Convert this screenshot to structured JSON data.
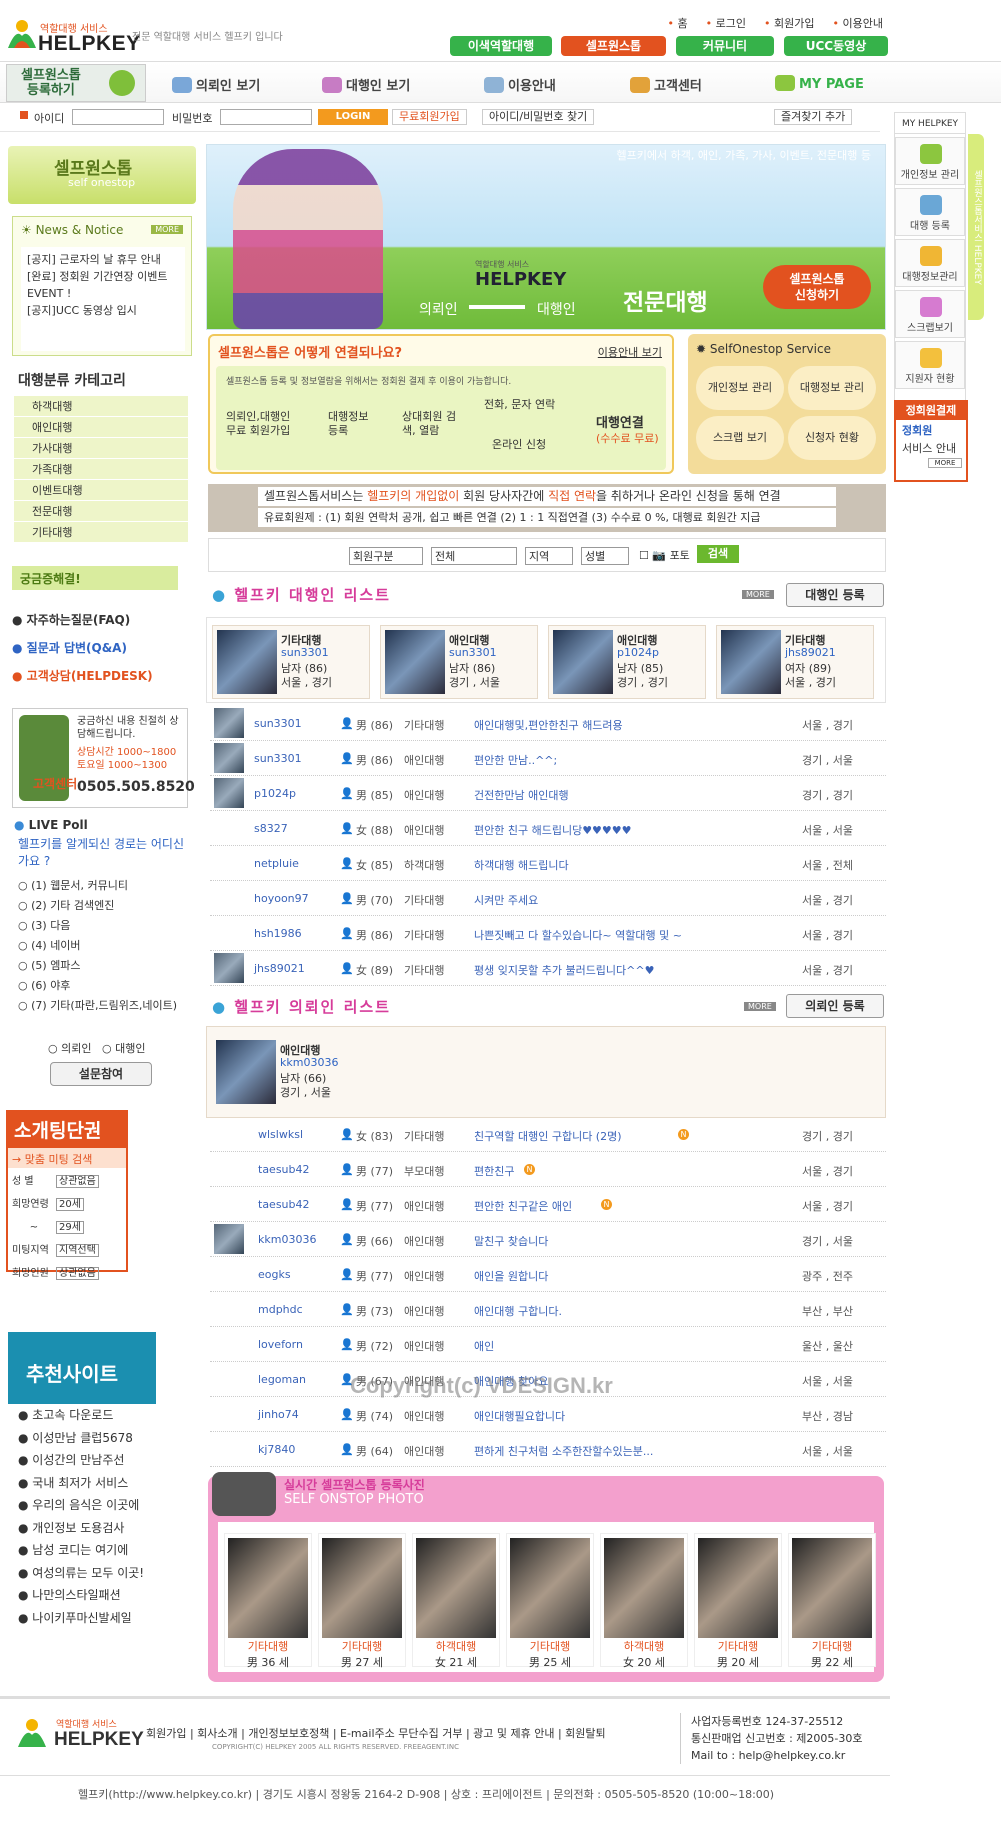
{
  "header": {
    "logo_small": "역할대행 서비스",
    "logo_text": "HELPKEY",
    "tagline": "전문 역할대행 서비스 헬프키 입니다",
    "toplinks": [
      "홈",
      "로그인",
      "회원가입",
      "이용안내"
    ],
    "tabs": [
      {
        "label": "이색역할대행",
        "color": "#36b24a"
      },
      {
        "label": "셀프원스톱",
        "color": "#e2521f"
      },
      {
        "label": "커뮤니티",
        "color": "#36b24a"
      },
      {
        "label": "UCC동영상",
        "color": "#36b24a"
      }
    ]
  },
  "nav": {
    "register": [
      "셀프원스톱",
      "등록하기"
    ],
    "items": [
      "의뢰인 보기",
      "대행인 보기",
      "이용안내",
      "고객센터",
      "MY PAGE"
    ]
  },
  "login": {
    "id_label": "아이디",
    "pw_label": "비밀번호",
    "login_btn": "LOGIN",
    "join": "무료회원가입",
    "find": "아이디/비밀번호 찾기",
    "fav": "즐겨찾기 추가"
  },
  "left": {
    "selfonestop": "셀프원스톱",
    "selfonestop_en": "self onestop",
    "news_title": "News & Notice",
    "news_more": "MORE",
    "news": [
      "[공지] 근로자의 날 휴무 안내",
      "[완료] 정회원 기간연장 이벤트 EVENT !",
      "[공지]UCC 동영상 입시"
    ],
    "category_title": "대행분류 카테고리",
    "categories": [
      "하객대행",
      "애인대행",
      "가사대행",
      "가족대행",
      "이벤트대행",
      "전문대행",
      "기타대행"
    ],
    "faq_title": "궁금증해결!",
    "faq": [
      "자주하는질문(FAQ)",
      "질문과 답변(Q&A)",
      "고객상담(HELPDESK)"
    ],
    "cs_text1": "궁금하신 내용 친절히 상담해드립니다.",
    "cs_hours1": "상담시간 1000~1800",
    "cs_hours2": "토요일 1000~1300",
    "cs_label": "고객센터",
    "cs_phone": "0505.505.8520",
    "poll_title": "LIVE Poll",
    "poll_question": "헬프키를 알게되신 경로는 어디신가요 ?",
    "poll_options": [
      "(1) 웹문서, 커뮤니티",
      "(2) 기타 검색엔진",
      "(3) 다음",
      "(4) 네이버",
      "(5) 엠파스",
      "(6) 야후",
      "(7) 기타(파란,드림위즈,네이트)"
    ],
    "poll_roles": [
      "의뢰인",
      "대행인"
    ],
    "poll_btn": "설문참여",
    "meeting_title": "소개팅단권",
    "meeting_search": "→ 맞춤 미팅 검색",
    "meeting_fields": [
      {
        "label": "성    별",
        "value": "상관없음"
      },
      {
        "label": "희망연령",
        "value": "20세"
      },
      {
        "label": "~",
        "value": "29세"
      },
      {
        "label": "미팅지역",
        "value": "지역선택"
      },
      {
        "label": "희망인원",
        "value": "상관없음"
      }
    ],
    "rec_title": "추천사이트",
    "rec": [
      "초고속 다운로드",
      "이성만남 클럽5678",
      "이성간의 만남주선",
      "국내 최저가 서비스",
      "우리의 음식은 이곳에",
      "개인정보 도용검사",
      "남성 코디는 여기에",
      "여성의류는 모두 이곳!",
      "나만의스타일패션",
      "나이키푸마신발세일"
    ]
  },
  "banner": {
    "top_text": "헬프키에서 하객, 애인, 가족, 가사, 이벤트, 전문대행 등",
    "brand_small": "역할대행 서비스",
    "brand": "HELPKEY",
    "left_word": "의뢰인",
    "right_word": "대행인",
    "big": "전문대행",
    "apply": [
      "셀프원스톱",
      "신청하기"
    ]
  },
  "howto": {
    "title": "셀프원스톱은 어떻게 연결되나요?",
    "guide": "이용안내 보기",
    "desc": "셀프원스톱 등록 및 정보열람을 위해서는 정회원 결제 후 이용이 가능합니다.",
    "steps": [
      "의뢰인,대행인 무료 회원가입",
      "대행정보 등록",
      "상대회원 검색, 열람",
      "전화, 문자 연락",
      "온라인 신청",
      "대행연결",
      "(수수료 무료)"
    ]
  },
  "service": {
    "title": "SelfOnestop Service",
    "items": [
      "개인정보 관리",
      "대행정보 관리",
      "스크랩 보기",
      "신청자 현황"
    ]
  },
  "notice": {
    "line1a": "셀프원스톱서비스는 ",
    "line1b": "헬프키의 개입없이",
    "line1c": " 회원 당사자간에 ",
    "line1d": "직접 연락",
    "line1e": "을 취하거나 온라인 신청을 통해 연결",
    "line2": "유료회원제 : (1) 회원 연락처 공개, 쉽고 빠른 연결 (2) 1 : 1 직접연결 (3) 수수료 0 %, 대행료 회원간 지급"
  },
  "search": {
    "member": "회원구분",
    "all": "전체",
    "region": "지역",
    "gender": "성별",
    "photo": "포토",
    "btn": "검색"
  },
  "agent_list": {
    "title": "헬프키 대행인 리스트",
    "more": "MORE",
    "register": "대행인 등록",
    "cards": [
      {
        "cat": "기타대행",
        "id": "sun3301",
        "info": "남자 (86)",
        "area": "서울 , 경기"
      },
      {
        "cat": "애인대행",
        "id": "sun3301",
        "info": "남자 (86)",
        "area": "경기 , 서울"
      },
      {
        "cat": "애인대행",
        "id": "p1024p",
        "info": "남자 (85)",
        "area": "경기 , 경기"
      },
      {
        "cat": "기타대행",
        "id": "jhs89021",
        "info": "여자 (89)",
        "area": "서울 , 경기"
      }
    ],
    "rows": [
      {
        "id": "sun3301",
        "sex": "男",
        "age": "(86)",
        "cat": "기타대행",
        "title": "애인대행및,편안한친구 해드려용",
        "area": "서울 , 경기",
        "photo": true
      },
      {
        "id": "sun3301",
        "sex": "男",
        "age": "(86)",
        "cat": "애인대행",
        "title": "편안한 만남..^^;",
        "area": "경기 , 서울",
        "photo": true
      },
      {
        "id": "p1024p",
        "sex": "男",
        "age": "(85)",
        "cat": "애인대행",
        "title": "건전한만남 애인대행",
        "area": "경기 , 경기",
        "photo": true
      },
      {
        "id": "s8327",
        "sex": "女",
        "age": "(88)",
        "cat": "애인대행",
        "title": "편안한 친구 해드립니당♥♥♥♥♥",
        "area": "서울 , 서울",
        "photo": false
      },
      {
        "id": "netpluie",
        "sex": "女",
        "age": "(85)",
        "cat": "하객대행",
        "title": "하객대행 해드립니다",
        "area": "서울 , 전체",
        "photo": false
      },
      {
        "id": "hoyoon97",
        "sex": "男",
        "age": "(70)",
        "cat": "기타대행",
        "title": "시켜만 주세요",
        "area": "서울 , 경기",
        "photo": false
      },
      {
        "id": "hsh1986",
        "sex": "男",
        "age": "(86)",
        "cat": "기타대행",
        "title": "나쁜짓빼고 다 할수있습니다~ 역할대행 및 ~",
        "area": "서울 , 경기",
        "photo": false
      },
      {
        "id": "jhs89021",
        "sex": "女",
        "age": "(89)",
        "cat": "기타대행",
        "title": "평생 잊지못할 추가 불러드립니다^^♥",
        "area": "서울 , 경기",
        "photo": true
      }
    ]
  },
  "client_list": {
    "title": "헬프키 의뢰인 리스트",
    "more": "MORE",
    "register": "의뢰인 등록",
    "card": {
      "cat": "애인대행",
      "id": "kkm03036",
      "info": "남자 (66)",
      "area": "경기 , 서울"
    },
    "rows": [
      {
        "id": "wlslwksl",
        "sex": "女",
        "age": "(83)",
        "cat": "기타대행",
        "title": "친구역할 대행인 구합니다 (2명)",
        "area": "경기 , 경기",
        "new": true,
        "photo": false
      },
      {
        "id": "taesub42",
        "sex": "男",
        "age": "(77)",
        "cat": "부모대행",
        "title": "편한친구",
        "area": "서울 , 경기",
        "new": true,
        "photo": false
      },
      {
        "id": "taesub42",
        "sex": "男",
        "age": "(77)",
        "cat": "애인대행",
        "title": "편안한 친구같은 애인",
        "area": "서울 , 경기",
        "new": true,
        "photo": false
      },
      {
        "id": "kkm03036",
        "sex": "男",
        "age": "(66)",
        "cat": "애인대행",
        "title": "말친구 찾습니다",
        "area": "경기 , 서울",
        "new": false,
        "photo": true
      },
      {
        "id": "eogks",
        "sex": "男",
        "age": "(77)",
        "cat": "애인대행",
        "title": "애인을 원합니다",
        "area": "광주 , 전주",
        "new": false,
        "photo": false
      },
      {
        "id": "mdphdc",
        "sex": "男",
        "age": "(73)",
        "cat": "애인대행",
        "title": "애인대행 구합니다.",
        "area": "부산 , 부산",
        "new": false,
        "photo": false
      },
      {
        "id": "loveforn",
        "sex": "男",
        "age": "(72)",
        "cat": "애인대행",
        "title": "애인",
        "area": "울산 , 울산",
        "new": false,
        "photo": false
      },
      {
        "id": "legoman",
        "sex": "男",
        "age": "(67)",
        "cat": "애인대행",
        "title": "애인대행 찾아요",
        "area": "서울 , 서울",
        "new": false,
        "photo": false
      },
      {
        "id": "jinho74",
        "sex": "男",
        "age": "(74)",
        "cat": "애인대행",
        "title": "애인대행필요합니다",
        "area": "부산 , 경남",
        "new": false,
        "photo": false
      },
      {
        "id": "kj7840",
        "sex": "男",
        "age": "(64)",
        "cat": "애인대행",
        "title": "편하게 친구처럼 소주한잔할수있는분...",
        "area": "서울 , 서울",
        "new": false,
        "photo": false
      }
    ]
  },
  "watermark": "Copyright(c) VDESIGN.kr",
  "photos": {
    "title": "실시간 셀프원스톱 등록사진",
    "subtitle": "SELF ONSTOP PHOTO",
    "items": [
      {
        "cat": "기타대행",
        "info": "男 36 세"
      },
      {
        "cat": "기타대행",
        "info": "男 27 세"
      },
      {
        "cat": "하객대행",
        "info": "女 21 세"
      },
      {
        "cat": "기타대행",
        "info": "男 25 세"
      },
      {
        "cat": "하객대행",
        "info": "女 20 세"
      },
      {
        "cat": "기타대행",
        "info": "男 20 세"
      },
      {
        "cat": "기타대행",
        "info": "男 22 세"
      }
    ]
  },
  "right": {
    "title": "MY HELPKEY",
    "items": [
      "개인정보 관리",
      "대행 등록",
      "대행정보관리",
      "스크랩보기",
      "지원자 현황"
    ],
    "vertical": "셀프원스톱서비스 HELPKEY",
    "member_title": "정회원결제",
    "member_body": [
      "정회원",
      "서비스 안내"
    ],
    "member_more": "MORE"
  },
  "footer": {
    "logo_small": "역할대행 서비스",
    "logo": "HELPKEY",
    "links": "회원가입 | 회사소개 | 개인정보보호정책 | E-mail주소 무단수집 거부 | 광고 및 제휴 안내 | 회원탈퇴",
    "copyright": "COPYRIGHT(C) HELPKEY 2005 ALL RIGHTS RESERVED. FREEAGENT.INC",
    "biz": [
      "사업자등록번호 124-37-25512",
      "통신판매업 신고번호 : 제2005-30호",
      "Mail to : help@helpkey.co.kr"
    ],
    "address": "헬프키(http://www.helpkey.co.kr) | 경기도 시흥시 정왕동 2164-2 D-908 | 상호 : 프리에이전트 | 문의전화 : 0505-505-8520 (10:00~18:00)"
  }
}
